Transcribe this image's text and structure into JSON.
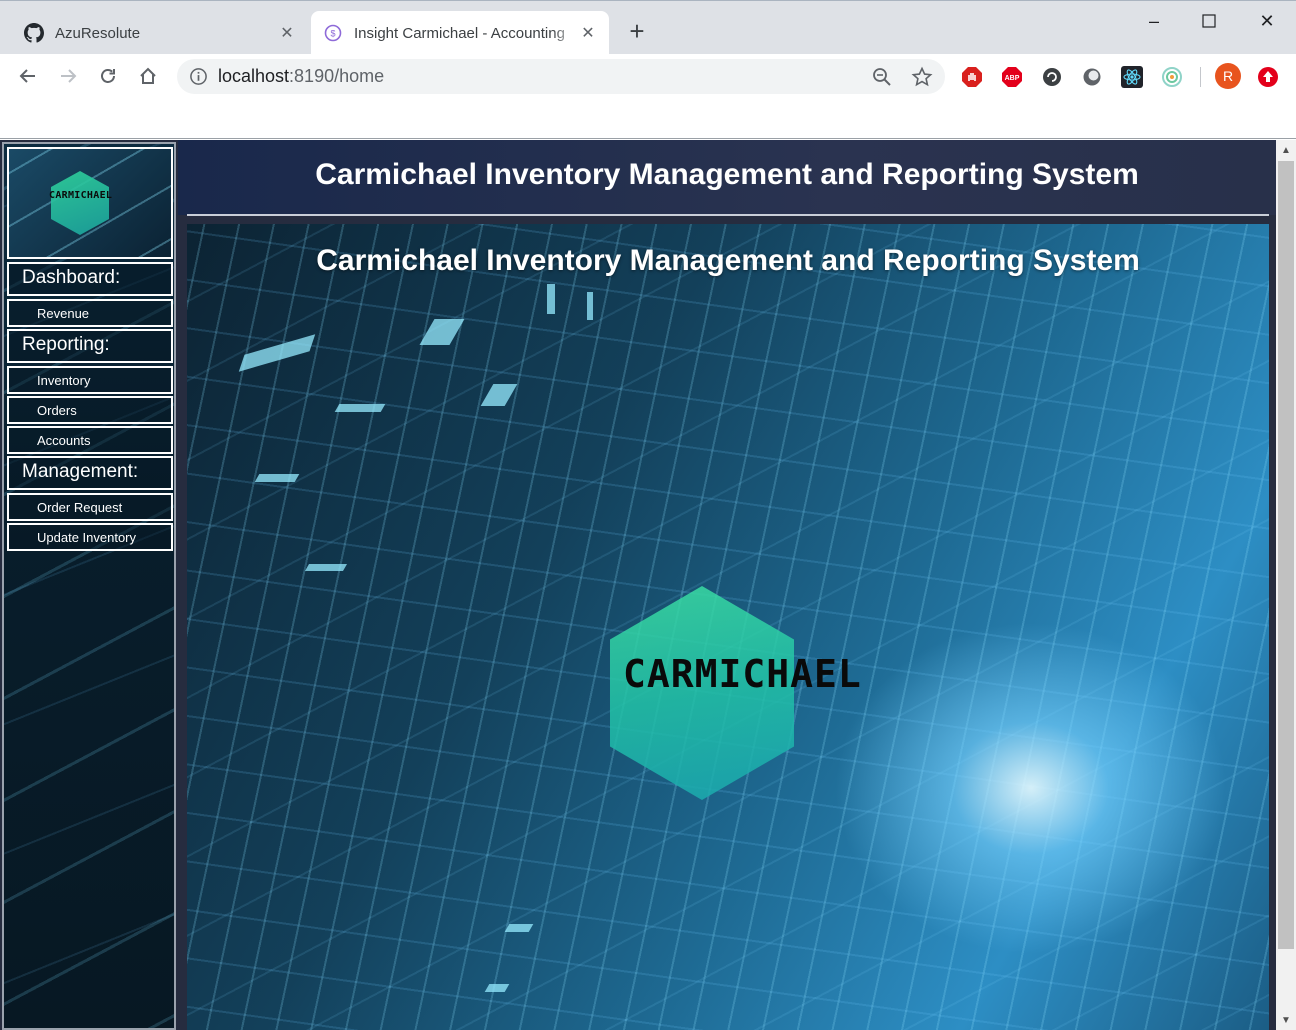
{
  "browser": {
    "tabs": [
      {
        "title": "AzuResolute",
        "icon": "github-icon",
        "active": false
      },
      {
        "title": "Insight Carmichael - Accounting",
        "icon": "site-favicon-icon",
        "active": true
      }
    ],
    "new_tab_label": "+",
    "window_controls": {
      "minimize": "–",
      "maximize": "☐",
      "close": "✕"
    },
    "url": {
      "host": "localhost",
      "path": ":8190/home"
    },
    "extensions": [
      "stop-sign-extension-icon",
      "adblock-plus-icon",
      "dark-circle-extension-icon",
      "gray-circle-extension-icon",
      "react-devtools-icon",
      "target-extension-icon"
    ],
    "profile_initial": "R"
  },
  "sidebar": {
    "logo_text": "CARMICHAEL",
    "sections": [
      {
        "label": "Dashboard:",
        "items": [
          {
            "label": "Revenue"
          }
        ]
      },
      {
        "label": "Reporting:",
        "items": [
          {
            "label": "Inventory"
          },
          {
            "label": "Orders"
          },
          {
            "label": "Accounts"
          }
        ]
      },
      {
        "label": "Management:",
        "items": [
          {
            "label": "Order Request"
          },
          {
            "label": "Update Inventory"
          }
        ]
      }
    ]
  },
  "main": {
    "title": "Carmichael Inventory Management and Reporting System",
    "hero": {
      "title": "Carmichael Inventory Management and Reporting System",
      "logo_text": "CARMICHAEL"
    }
  },
  "colors": {
    "header_bg": "#19284b",
    "page_bg": "#262c3f",
    "logo_hex": "#2fd39b",
    "profile_avatar": "#e8541e",
    "adblock_red": "#e3001b"
  }
}
